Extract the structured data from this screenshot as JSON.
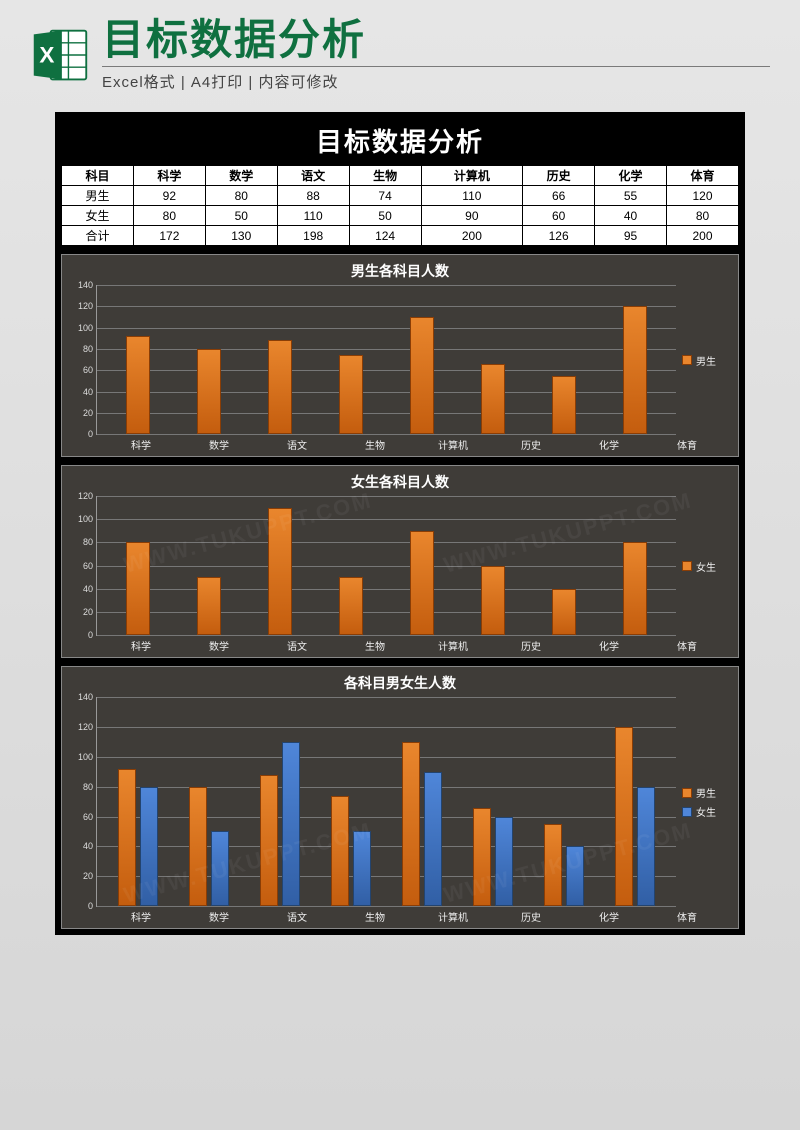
{
  "header": {
    "title": "目标数据分析",
    "subtitle": "Excel格式 | A4打印 | 内容可修改"
  },
  "sheet_title": "目标数据分析",
  "table": {
    "row_labels": [
      "科目",
      "男生",
      "女生",
      "合计"
    ],
    "columns": [
      "科学",
      "数学",
      "语文",
      "生物",
      "计算机",
      "历史",
      "化学",
      "体育"
    ],
    "male": [
      92,
      80,
      88,
      74,
      110,
      66,
      55,
      120
    ],
    "female": [
      80,
      50,
      110,
      50,
      90,
      60,
      40,
      80
    ],
    "total": [
      172,
      130,
      198,
      124,
      200,
      126,
      95,
      200
    ]
  },
  "chart_data": [
    {
      "type": "bar",
      "title": "男生各科目人数",
      "categories": [
        "科学",
        "数学",
        "语文",
        "生物",
        "计算机",
        "历史",
        "化学",
        "体育"
      ],
      "series": [
        {
          "name": "男生",
          "values": [
            92,
            80,
            88,
            74,
            110,
            66,
            55,
            120
          ],
          "color": "#e9862d"
        }
      ],
      "ylim": [
        0,
        140
      ],
      "ystep": 20
    },
    {
      "type": "bar",
      "title": "女生各科目人数",
      "categories": [
        "科学",
        "数学",
        "语文",
        "生物",
        "计算机",
        "历史",
        "化学",
        "体育"
      ],
      "series": [
        {
          "name": "女生",
          "values": [
            80,
            50,
            110,
            50,
            90,
            60,
            40,
            80
          ],
          "color": "#e9862d"
        }
      ],
      "ylim": [
        0,
        120
      ],
      "ystep": 20
    },
    {
      "type": "bar",
      "title": "各科目男女生人数",
      "categories": [
        "科学",
        "数学",
        "语文",
        "生物",
        "计算机",
        "历史",
        "化学",
        "体育"
      ],
      "series": [
        {
          "name": "男生",
          "values": [
            92,
            80,
            88,
            74,
            110,
            66,
            55,
            120
          ],
          "color": "#e9862d"
        },
        {
          "name": "女生",
          "values": [
            80,
            50,
            110,
            50,
            90,
            60,
            40,
            80
          ],
          "color": "#4f86d9"
        }
      ],
      "ylim": [
        0,
        140
      ],
      "ystep": 20
    }
  ],
  "watermark": "WWW.TUKUPPT.COM"
}
